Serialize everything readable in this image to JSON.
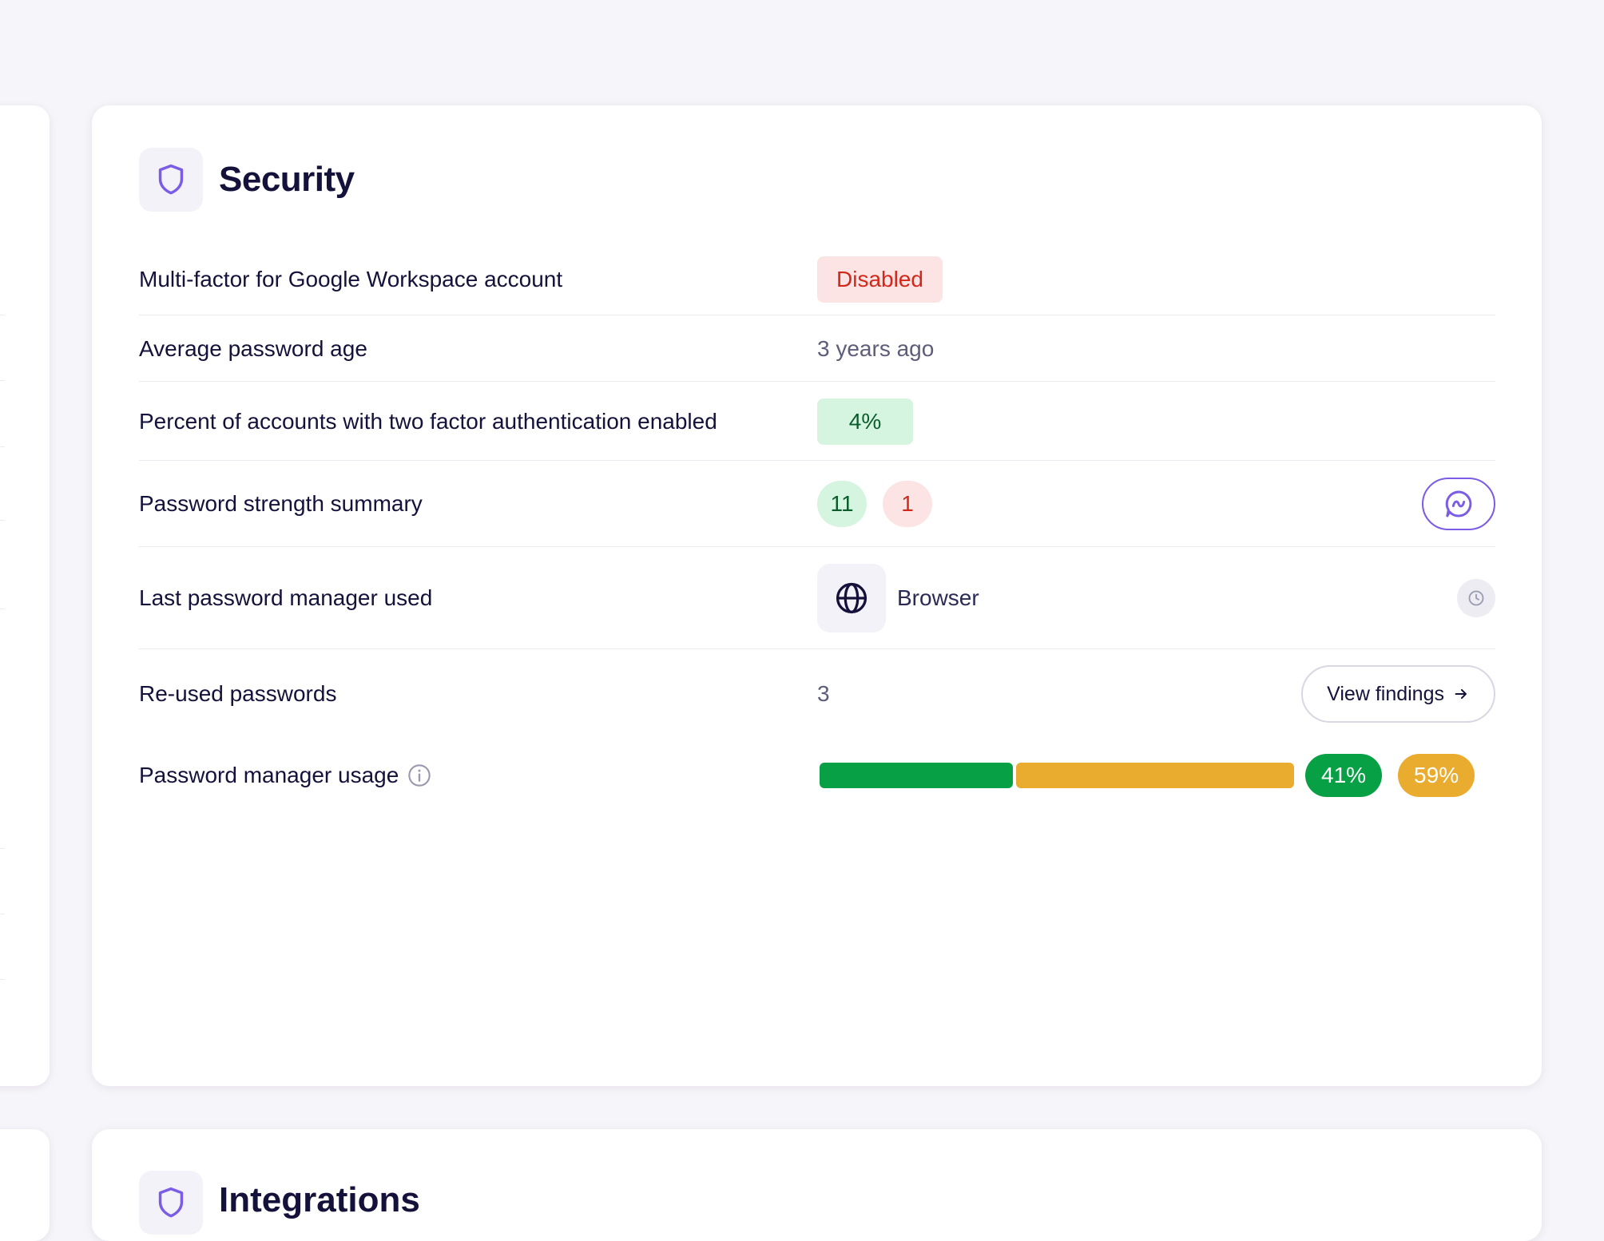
{
  "colors": {
    "background": "#f6f5f9",
    "card": "#ffffff",
    "accent": "#7b5ce6",
    "danger_bg": "#fde4e4",
    "danger_text": "#d0281b",
    "success_bg": "#d5f5e1",
    "success_text": "#0b5b2c",
    "usage_green": "#08a045",
    "usage_amber": "#eaac2f"
  },
  "security": {
    "title": "Security",
    "icon": "shield-icon",
    "rows": {
      "mfa": {
        "label": "Multi-factor for Google Workspace account",
        "value": "Disabled"
      },
      "password_age": {
        "label": "Average password age",
        "value": "3 years ago"
      },
      "two_factor": {
        "label": "Percent of accounts with two factor authentication enabled",
        "value": "4%"
      },
      "strength": {
        "label": "Password strength summary",
        "strong": "11",
        "weak": "1",
        "action_icon": "chat-wave-icon"
      },
      "manager": {
        "label": "Last password manager used",
        "value": "Browser",
        "icon": "globe-icon",
        "action_icon": "clock-icon"
      },
      "reused": {
        "label": "Re-used passwords",
        "value": "3",
        "button_label": "View findings",
        "button_icon": "arrow-right-icon"
      },
      "usage": {
        "label": "Password manager usage",
        "info_icon": "info-icon",
        "using_percent": 41,
        "not_using_percent": 59,
        "using_label": "41%",
        "not_using_label": "59%"
      }
    }
  },
  "next_section": {
    "title": "Integrations"
  }
}
